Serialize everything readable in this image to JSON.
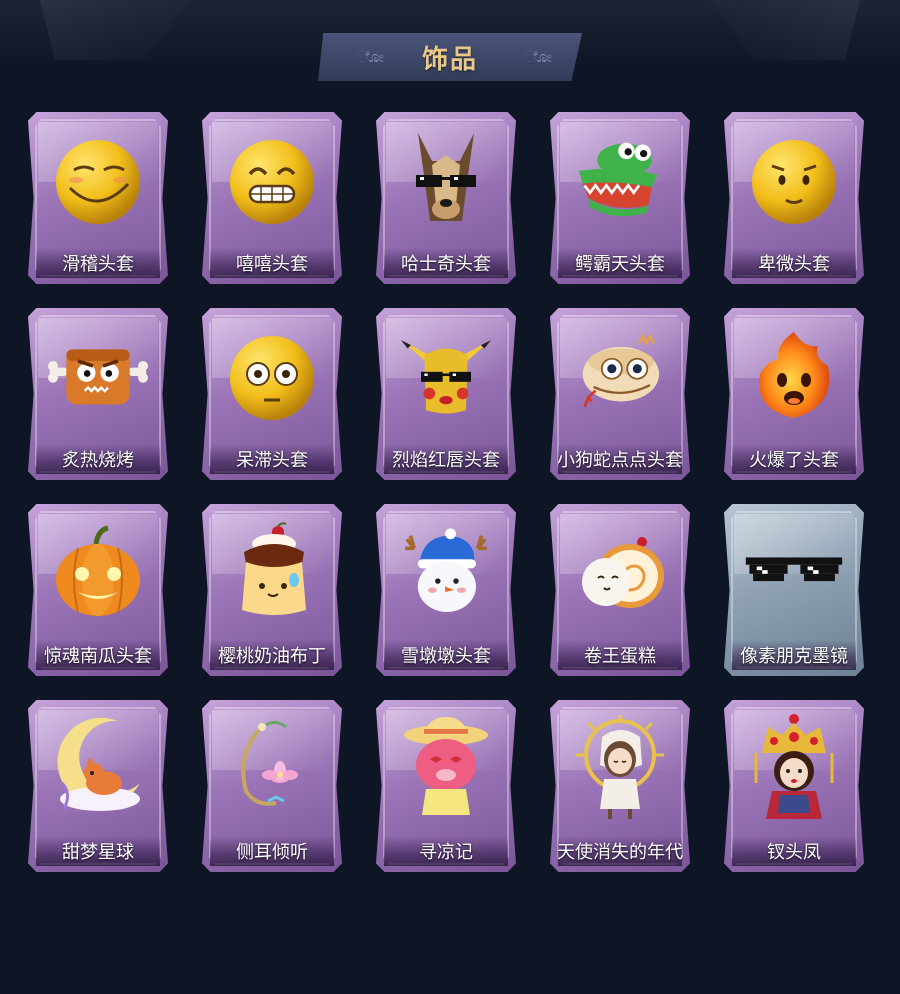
{
  "title": "饰品",
  "items": [
    {
      "name": "滑稽头套",
      "icon": "smirk-face-mask-icon",
      "style": "purple"
    },
    {
      "name": "嘻嘻头套",
      "icon": "grin-face-mask-icon",
      "style": "purple"
    },
    {
      "name": "哈士奇头套",
      "icon": "husky-sunglasses-mask-icon",
      "style": "purple"
    },
    {
      "name": "鳄霸天头套",
      "icon": "crocodile-mask-icon",
      "style": "purple"
    },
    {
      "name": "卑微头套",
      "icon": "humble-face-mask-icon",
      "style": "purple"
    },
    {
      "name": "炙热烧烤",
      "icon": "grilled-meat-icon",
      "style": "purple"
    },
    {
      "name": "呆滞头套",
      "icon": "dazed-face-mask-icon",
      "style": "purple"
    },
    {
      "name": "烈焰红唇头套",
      "icon": "pikachu-red-lips-mask-icon",
      "style": "purple"
    },
    {
      "name": "小狗蛇点点头套",
      "icon": "snake-mask-icon",
      "style": "purple"
    },
    {
      "name": "火爆了头套",
      "icon": "fireball-mask-icon",
      "style": "purple"
    },
    {
      "name": "惊魂南瓜头套",
      "icon": "pumpkin-mask-icon",
      "style": "purple"
    },
    {
      "name": "樱桃奶油布丁",
      "icon": "cherry-pudding-icon",
      "style": "purple"
    },
    {
      "name": "雪墩墩头套",
      "icon": "snowman-reindeer-mask-icon",
      "style": "purple"
    },
    {
      "name": "卷王蛋糕",
      "icon": "roll-cake-icon",
      "style": "purple"
    },
    {
      "name": "像素朋克墨镜",
      "icon": "pixel-sunglasses-icon",
      "style": "blue"
    },
    {
      "name": "甜梦星球",
      "icon": "moon-fox-icon",
      "style": "purple"
    },
    {
      "name": "侧耳倾听",
      "icon": "flower-ear-decoration-icon",
      "style": "purple"
    },
    {
      "name": "寻凉记",
      "icon": "pink-bear-sunhat-icon",
      "style": "purple"
    },
    {
      "name": "天使消失的年代",
      "icon": "angel-girl-halo-icon",
      "style": "purple"
    },
    {
      "name": "钗头凤",
      "icon": "phoenix-crown-opera-icon",
      "style": "purple"
    }
  ]
}
